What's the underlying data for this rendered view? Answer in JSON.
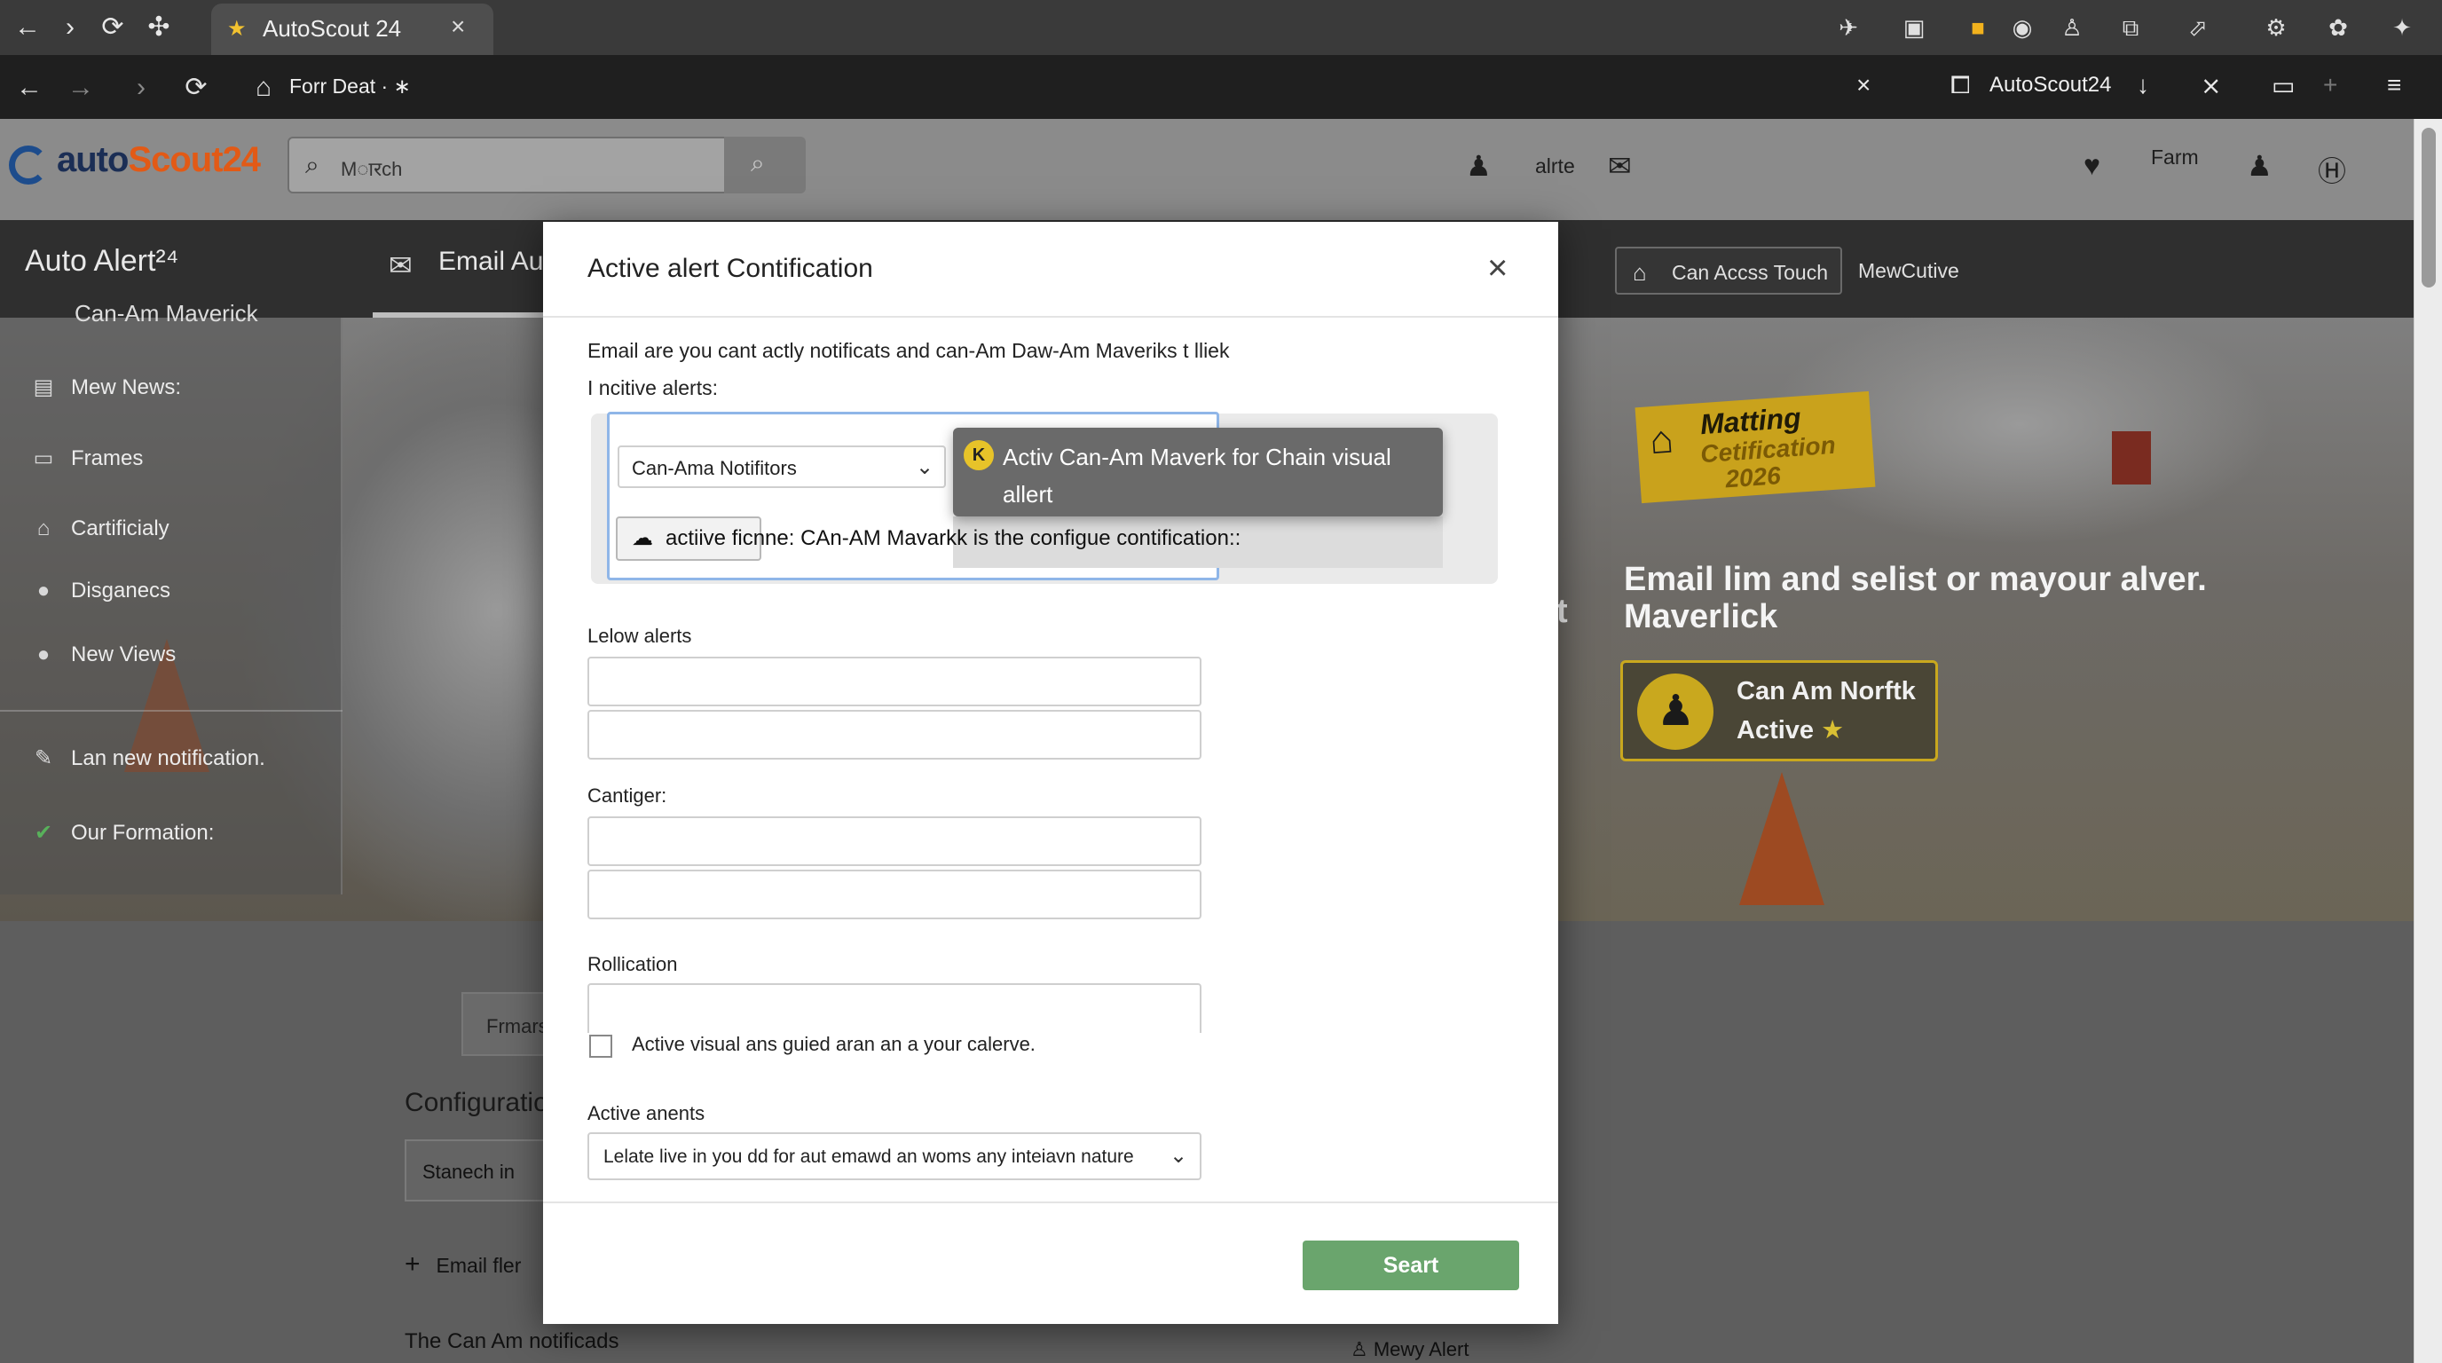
{
  "browser": {
    "tab_title": "AutoScout 24",
    "address": "Forr Deat · ∗",
    "right_tab": "AutoScout24"
  },
  "site": {
    "logo": {
      "part1": "auto",
      "part2": "Scout",
      "part3": "24"
    },
    "search_placeholder": "Mारch",
    "header_user": "alrte",
    "header_farm": "Farm"
  },
  "nav": {
    "title": "Auto Alert²⁴",
    "tab": "Email Au",
    "touch_btn": "Can Accss Touch",
    "mewcutive": "MewCutive"
  },
  "sidebar": {
    "cut_label": "Can-Am Maverick",
    "items": [
      {
        "icon": "news-icon",
        "label": "Mew News:"
      },
      {
        "icon": "frames-icon",
        "label": "Frames"
      },
      {
        "icon": "certificate-icon",
        "label": "Cartificialy"
      },
      {
        "icon": "disguise-icon",
        "label": "Disganecs"
      },
      {
        "icon": "views-icon",
        "label": "New Views"
      },
      {
        "icon": "wrench-icon",
        "label": "Lan new notification."
      },
      {
        "icon": "check-icon",
        "label": "Our Formation:"
      }
    ]
  },
  "hero": {
    "badge": {
      "l1": "Matting",
      "l2": "Cetification",
      "l3": "2026"
    },
    "headline": "Email lim and selist or mayour alver. Maverlick",
    "cut_t": "t",
    "status_card": {
      "name": "Can Am Norftk",
      "status": "Active",
      "star": "★"
    }
  },
  "lower": {
    "frm_btn": "Frmars",
    "config_title": "Configuratio",
    "stanech_btn": "Stanech in",
    "email_fler": "Email fler",
    "can_am_notif": "The Can Am notificads",
    "mewy_alert": "Mewy Alert"
  },
  "modal": {
    "title": "Active alert Contification",
    "desc": "Email are you cant actly notificats and can-Am Daw-Am Maveriks t lliek",
    "sub": "I ncitive alerts:",
    "dropdown_value": "Can-Ama Notifitors",
    "tooltip": "Activ Can-Am Maverk for Chain visual allert",
    "config_row": "actiive ficnne: CAn-AM Mavarkk is the configue contification::",
    "label_lelow": "Lelow alerts",
    "label_cantiger": "Cantiger:",
    "label_rollication": "Rollication",
    "checkbox_label": "Active visual ans guied aran an a your calerve.",
    "label_active_anents": "Active anents",
    "select_value": "Lelate live in you dd for aut emawd an woms any inteiavn nature",
    "primary_btn": "Seart"
  }
}
